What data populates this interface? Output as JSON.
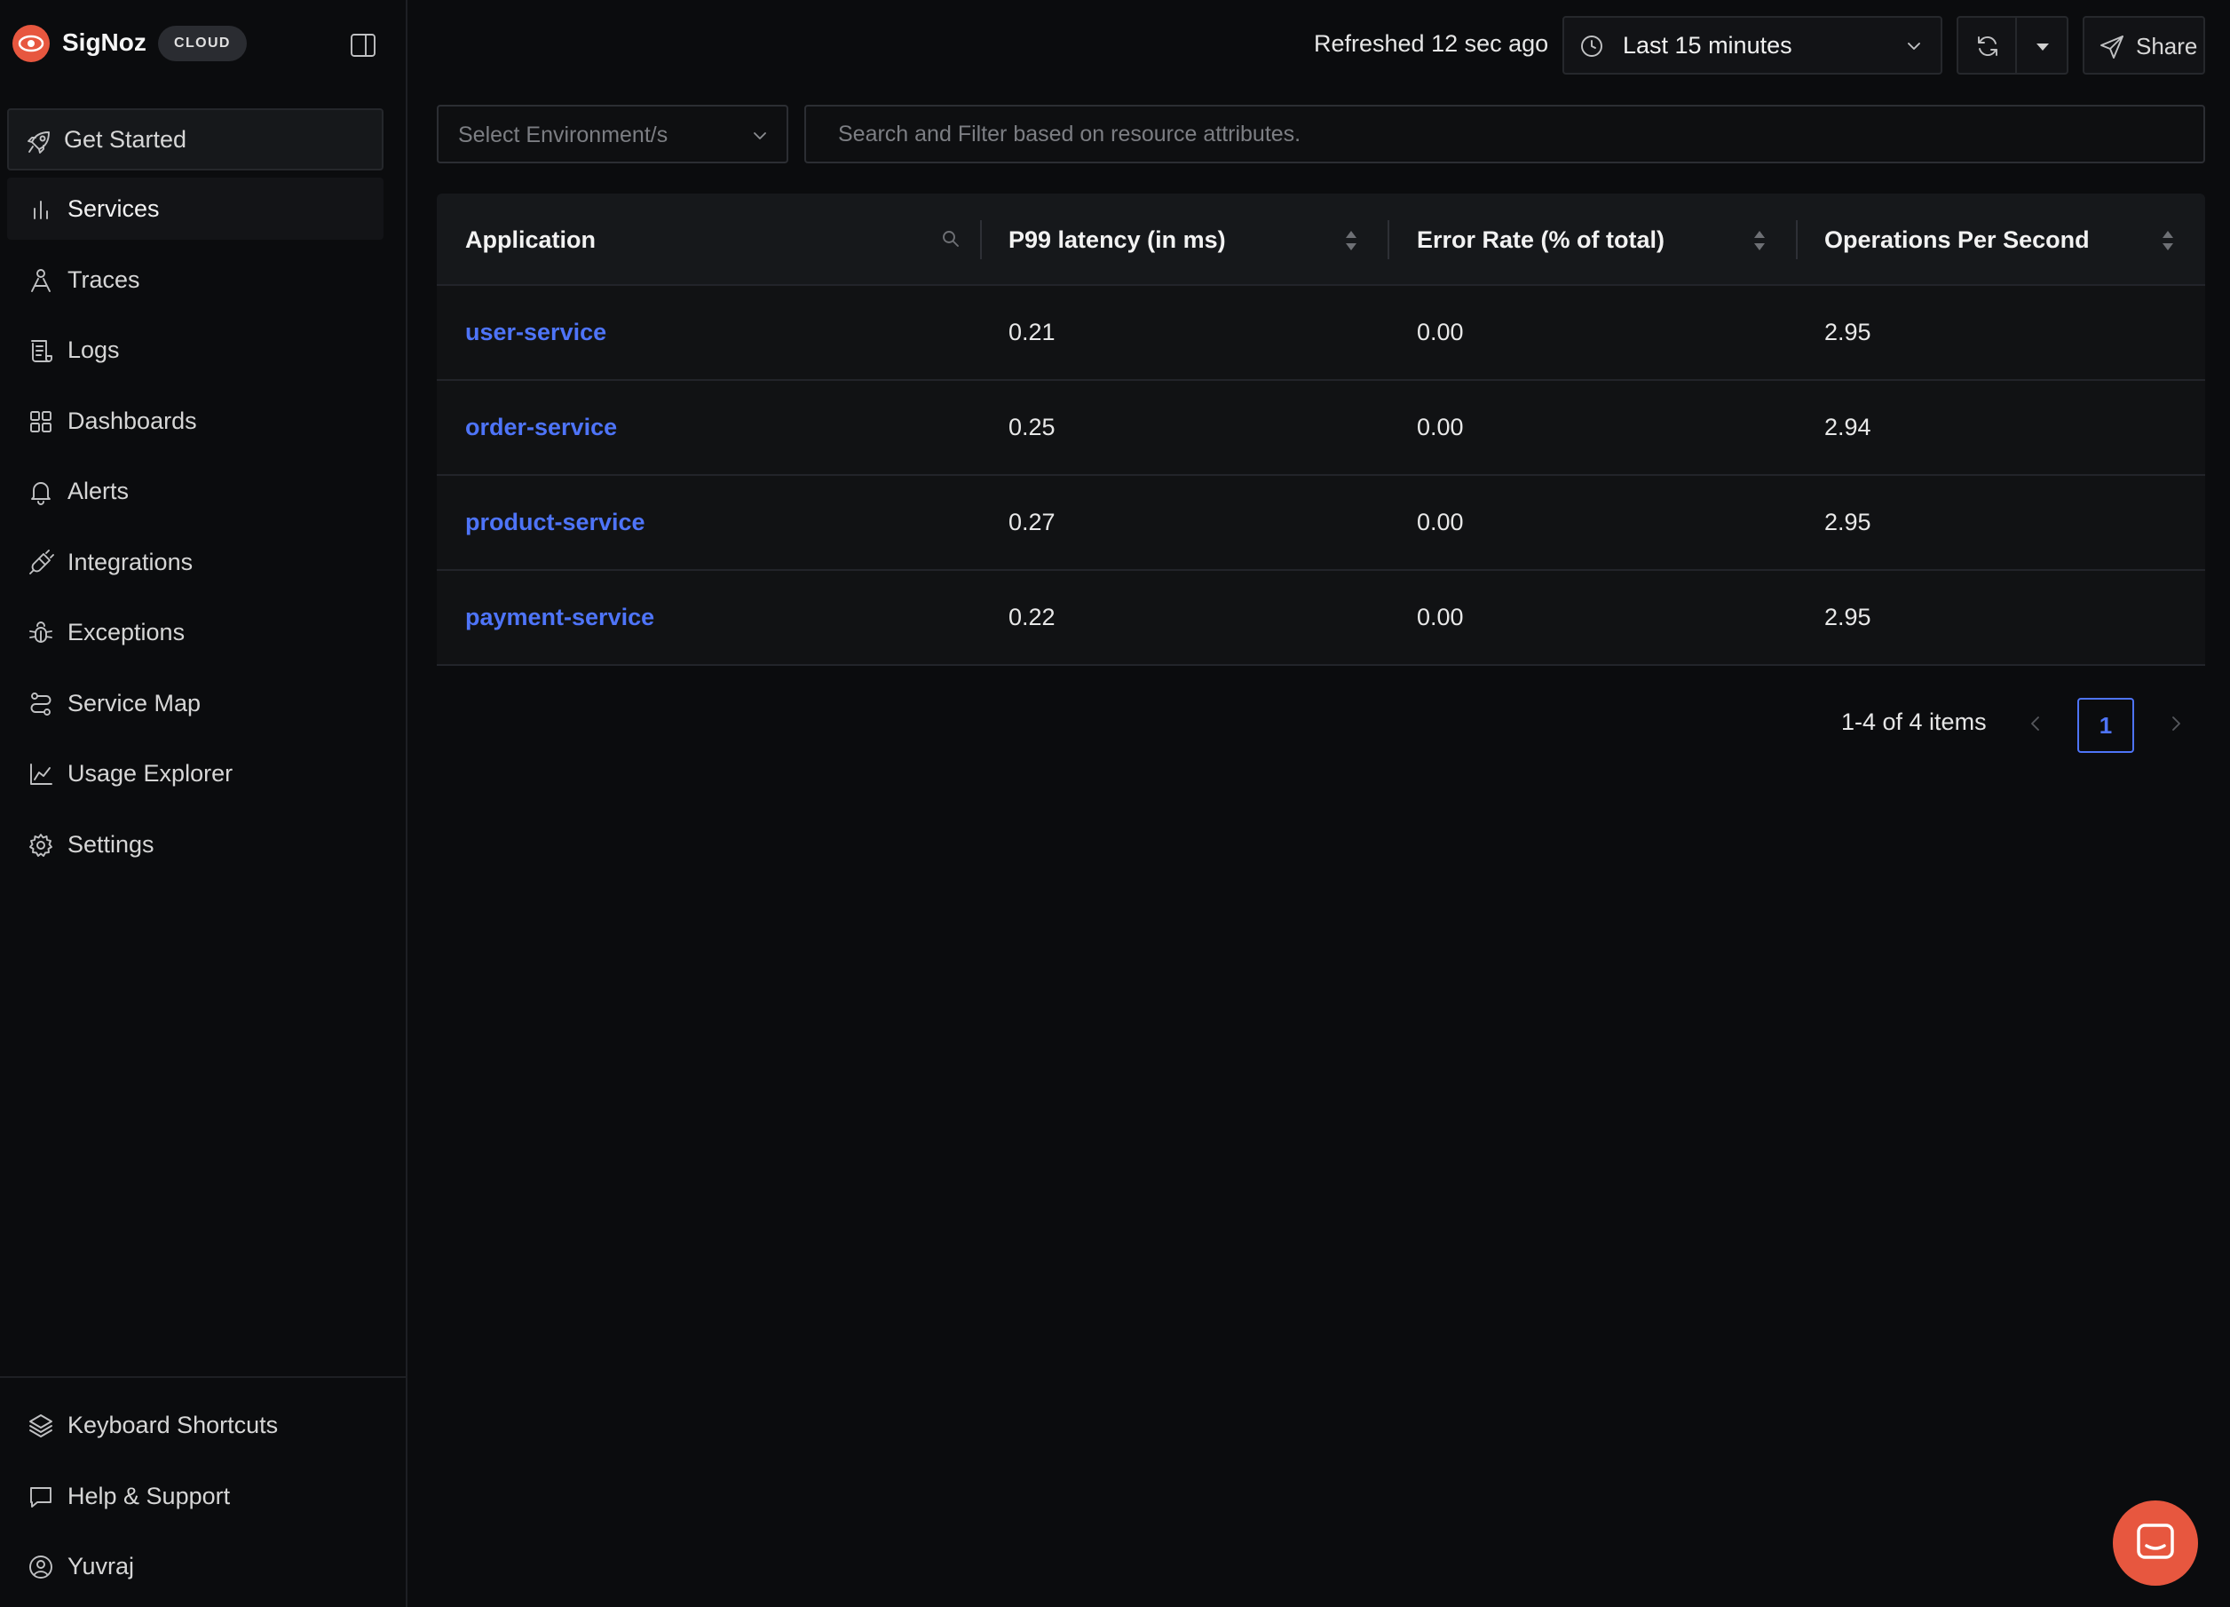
{
  "brand": {
    "name": "SigNoz",
    "badge": "CLOUD",
    "accent": "#e7573f"
  },
  "sidebar": {
    "items": [
      {
        "label": "Get Started",
        "icon": "rocket-icon"
      },
      {
        "label": "Services",
        "icon": "bar-chart-icon",
        "active": true
      },
      {
        "label": "Traces",
        "icon": "traces-icon"
      },
      {
        "label": "Logs",
        "icon": "logs-icon"
      },
      {
        "label": "Dashboards",
        "icon": "dashboard-grid-icon"
      },
      {
        "label": "Alerts",
        "icon": "bell-icon"
      },
      {
        "label": "Integrations",
        "icon": "plug-icon"
      },
      {
        "label": "Exceptions",
        "icon": "bug-icon"
      },
      {
        "label": "Service Map",
        "icon": "route-icon"
      },
      {
        "label": "Usage Explorer",
        "icon": "area-chart-icon"
      },
      {
        "label": "Settings",
        "icon": "gear-icon"
      }
    ],
    "bottom": [
      {
        "label": "Keyboard Shortcuts",
        "icon": "layers-icon"
      },
      {
        "label": "Help & Support",
        "icon": "message-icon"
      },
      {
        "label": "Yuvraj",
        "icon": "user-circle-icon"
      }
    ]
  },
  "header": {
    "refreshed": "Refreshed 12 sec ago",
    "time_range": "Last 15 minutes",
    "share": "Share"
  },
  "filters": {
    "environment_placeholder": "Select Environment/s",
    "search_placeholder": "Search and Filter based on resource attributes."
  },
  "table": {
    "columns": [
      "Application",
      "P99 latency (in ms)",
      "Error Rate (% of total)",
      "Operations Per Second"
    ],
    "rows": [
      {
        "application": "user-service",
        "p99": "0.21",
        "error_rate": "0.00",
        "ops": "2.95"
      },
      {
        "application": "order-service",
        "p99": "0.25",
        "error_rate": "0.00",
        "ops": "2.94"
      },
      {
        "application": "product-service",
        "p99": "0.27",
        "error_rate": "0.00",
        "ops": "2.95"
      },
      {
        "application": "payment-service",
        "p99": "0.22",
        "error_rate": "0.00",
        "ops": "2.95"
      }
    ]
  },
  "pagination": {
    "summary": "1-4 of 4 items",
    "current_page": "1"
  },
  "colors": {
    "link": "#4e74f8",
    "background": "#0b0c0e"
  }
}
